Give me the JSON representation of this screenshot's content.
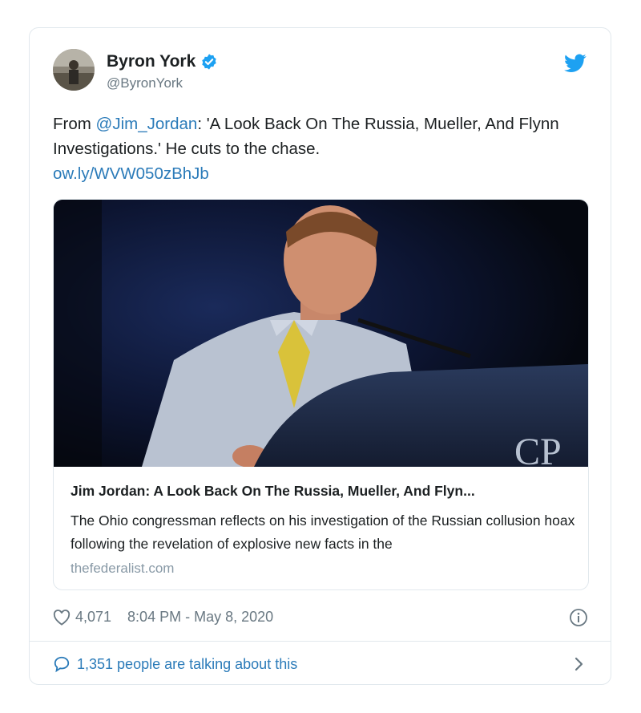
{
  "tweet": {
    "author": {
      "name": "Byron York",
      "handle": "@ByronYork",
      "verified": true
    },
    "text": {
      "prefix": "From ",
      "mention": "@Jim_Jordan",
      "body": ": 'A Look Back On The Russia, Mueller, And Flynn Investigations.' He cuts to the chase.",
      "url": "ow.ly/WVW050zBhJb"
    },
    "card": {
      "image_alt": "Jim Jordan at a podium",
      "title": "Jim Jordan: A Look Back On The Russia, Mueller, And Flyn...",
      "description": "The Ohio congressman reflects on his investigation of the Russian collusion hoax following the revelation of explosive new facts in the",
      "domain": "thefederalist.com"
    },
    "likes": "4,071",
    "timestamp": "8:04 PM - May 8, 2020",
    "conversation": "1,351 people are talking about this"
  },
  "colors": {
    "link": "#2b7bb9",
    "verified": "#1da1f2",
    "twitter_bird": "#1da1f2",
    "muted": "#697882"
  },
  "icons": [
    "verified-badge-icon",
    "twitter-bird-icon",
    "heart-icon",
    "info-icon",
    "speech-bubble-icon",
    "chevron-right-icon"
  ]
}
